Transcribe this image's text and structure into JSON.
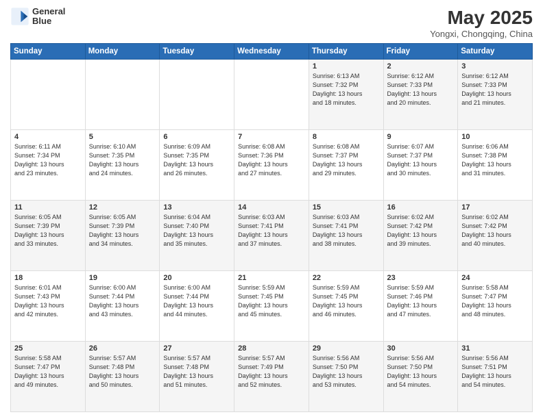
{
  "header": {
    "logo_line1": "General",
    "logo_line2": "Blue",
    "month_year": "May 2025",
    "location": "Yongxi, Chongqing, China"
  },
  "days_of_week": [
    "Sunday",
    "Monday",
    "Tuesday",
    "Wednesday",
    "Thursday",
    "Friday",
    "Saturday"
  ],
  "weeks": [
    [
      {
        "day": "",
        "info": ""
      },
      {
        "day": "",
        "info": ""
      },
      {
        "day": "",
        "info": ""
      },
      {
        "day": "",
        "info": ""
      },
      {
        "day": "1",
        "info": "Sunrise: 6:13 AM\nSunset: 7:32 PM\nDaylight: 13 hours\nand 18 minutes."
      },
      {
        "day": "2",
        "info": "Sunrise: 6:12 AM\nSunset: 7:33 PM\nDaylight: 13 hours\nand 20 minutes."
      },
      {
        "day": "3",
        "info": "Sunrise: 6:12 AM\nSunset: 7:33 PM\nDaylight: 13 hours\nand 21 minutes."
      }
    ],
    [
      {
        "day": "4",
        "info": "Sunrise: 6:11 AM\nSunset: 7:34 PM\nDaylight: 13 hours\nand 23 minutes."
      },
      {
        "day": "5",
        "info": "Sunrise: 6:10 AM\nSunset: 7:35 PM\nDaylight: 13 hours\nand 24 minutes."
      },
      {
        "day": "6",
        "info": "Sunrise: 6:09 AM\nSunset: 7:35 PM\nDaylight: 13 hours\nand 26 minutes."
      },
      {
        "day": "7",
        "info": "Sunrise: 6:08 AM\nSunset: 7:36 PM\nDaylight: 13 hours\nand 27 minutes."
      },
      {
        "day": "8",
        "info": "Sunrise: 6:08 AM\nSunset: 7:37 PM\nDaylight: 13 hours\nand 29 minutes."
      },
      {
        "day": "9",
        "info": "Sunrise: 6:07 AM\nSunset: 7:37 PM\nDaylight: 13 hours\nand 30 minutes."
      },
      {
        "day": "10",
        "info": "Sunrise: 6:06 AM\nSunset: 7:38 PM\nDaylight: 13 hours\nand 31 minutes."
      }
    ],
    [
      {
        "day": "11",
        "info": "Sunrise: 6:05 AM\nSunset: 7:39 PM\nDaylight: 13 hours\nand 33 minutes."
      },
      {
        "day": "12",
        "info": "Sunrise: 6:05 AM\nSunset: 7:39 PM\nDaylight: 13 hours\nand 34 minutes."
      },
      {
        "day": "13",
        "info": "Sunrise: 6:04 AM\nSunset: 7:40 PM\nDaylight: 13 hours\nand 35 minutes."
      },
      {
        "day": "14",
        "info": "Sunrise: 6:03 AM\nSunset: 7:41 PM\nDaylight: 13 hours\nand 37 minutes."
      },
      {
        "day": "15",
        "info": "Sunrise: 6:03 AM\nSunset: 7:41 PM\nDaylight: 13 hours\nand 38 minutes."
      },
      {
        "day": "16",
        "info": "Sunrise: 6:02 AM\nSunset: 7:42 PM\nDaylight: 13 hours\nand 39 minutes."
      },
      {
        "day": "17",
        "info": "Sunrise: 6:02 AM\nSunset: 7:42 PM\nDaylight: 13 hours\nand 40 minutes."
      }
    ],
    [
      {
        "day": "18",
        "info": "Sunrise: 6:01 AM\nSunset: 7:43 PM\nDaylight: 13 hours\nand 42 minutes."
      },
      {
        "day": "19",
        "info": "Sunrise: 6:00 AM\nSunset: 7:44 PM\nDaylight: 13 hours\nand 43 minutes."
      },
      {
        "day": "20",
        "info": "Sunrise: 6:00 AM\nSunset: 7:44 PM\nDaylight: 13 hours\nand 44 minutes."
      },
      {
        "day": "21",
        "info": "Sunrise: 5:59 AM\nSunset: 7:45 PM\nDaylight: 13 hours\nand 45 minutes."
      },
      {
        "day": "22",
        "info": "Sunrise: 5:59 AM\nSunset: 7:45 PM\nDaylight: 13 hours\nand 46 minutes."
      },
      {
        "day": "23",
        "info": "Sunrise: 5:59 AM\nSunset: 7:46 PM\nDaylight: 13 hours\nand 47 minutes."
      },
      {
        "day": "24",
        "info": "Sunrise: 5:58 AM\nSunset: 7:47 PM\nDaylight: 13 hours\nand 48 minutes."
      }
    ],
    [
      {
        "day": "25",
        "info": "Sunrise: 5:58 AM\nSunset: 7:47 PM\nDaylight: 13 hours\nand 49 minutes."
      },
      {
        "day": "26",
        "info": "Sunrise: 5:57 AM\nSunset: 7:48 PM\nDaylight: 13 hours\nand 50 minutes."
      },
      {
        "day": "27",
        "info": "Sunrise: 5:57 AM\nSunset: 7:48 PM\nDaylight: 13 hours\nand 51 minutes."
      },
      {
        "day": "28",
        "info": "Sunrise: 5:57 AM\nSunset: 7:49 PM\nDaylight: 13 hours\nand 52 minutes."
      },
      {
        "day": "29",
        "info": "Sunrise: 5:56 AM\nSunset: 7:50 PM\nDaylight: 13 hours\nand 53 minutes."
      },
      {
        "day": "30",
        "info": "Sunrise: 5:56 AM\nSunset: 7:50 PM\nDaylight: 13 hours\nand 54 minutes."
      },
      {
        "day": "31",
        "info": "Sunrise: 5:56 AM\nSunset: 7:51 PM\nDaylight: 13 hours\nand 54 minutes."
      }
    ]
  ]
}
